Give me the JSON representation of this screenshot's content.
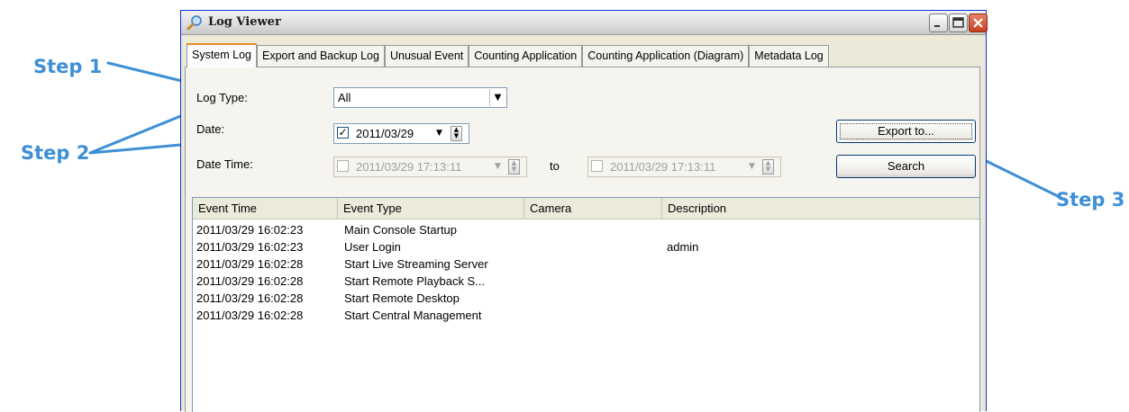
{
  "annotations": {
    "step1": "Step 1",
    "step2": "Step 2",
    "step3": "Step 3",
    "color": "#3d8fd6"
  },
  "window": {
    "title": "Log Viewer",
    "title_icon": "magnifier-icon",
    "controls": [
      "minimize-icon",
      "maximize-icon",
      "close-icon"
    ]
  },
  "tabs": [
    {
      "label": "System Log",
      "active": true
    },
    {
      "label": "Export and Backup Log"
    },
    {
      "label": "Unusual Event"
    },
    {
      "label": "Counting Application"
    },
    {
      "label": "Counting Application (Diagram)"
    },
    {
      "label": "Metadata Log"
    }
  ],
  "filters": {
    "log_type_label": "Log Type:",
    "log_type_value": "All",
    "date_label": "Date:",
    "date_value": "2011/03/29",
    "date_checked": true,
    "datetime_label": "Date Time:",
    "datetime_from": "2011/03/29 17:13:11",
    "datetime_to_label": "to",
    "datetime_to": "2011/03/29 17:13:11"
  },
  "buttons": {
    "export": "Export to...",
    "search": "Search"
  },
  "list": {
    "columns": [
      "Event Time",
      "Event Type",
      "Camera",
      "Description"
    ],
    "rows": [
      {
        "time": "2011/03/29 16:02:23",
        "type": "Main Console Startup",
        "camera": "",
        "description": ""
      },
      {
        "time": "2011/03/29 16:02:23",
        "type": "User Login",
        "camera": "",
        "description": "admin"
      },
      {
        "time": "2011/03/29 16:02:28",
        "type": "Start Live Streaming Server",
        "camera": "",
        "description": ""
      },
      {
        "time": "2011/03/29 16:02:28",
        "type": "Start Remote Playback S...",
        "camera": "",
        "description": ""
      },
      {
        "time": "2011/03/29 16:02:28",
        "type": "Start Remote Desktop",
        "camera": "",
        "description": ""
      },
      {
        "time": "2011/03/29 16:02:28",
        "type": "Start Central Management",
        "camera": "",
        "description": ""
      }
    ]
  }
}
